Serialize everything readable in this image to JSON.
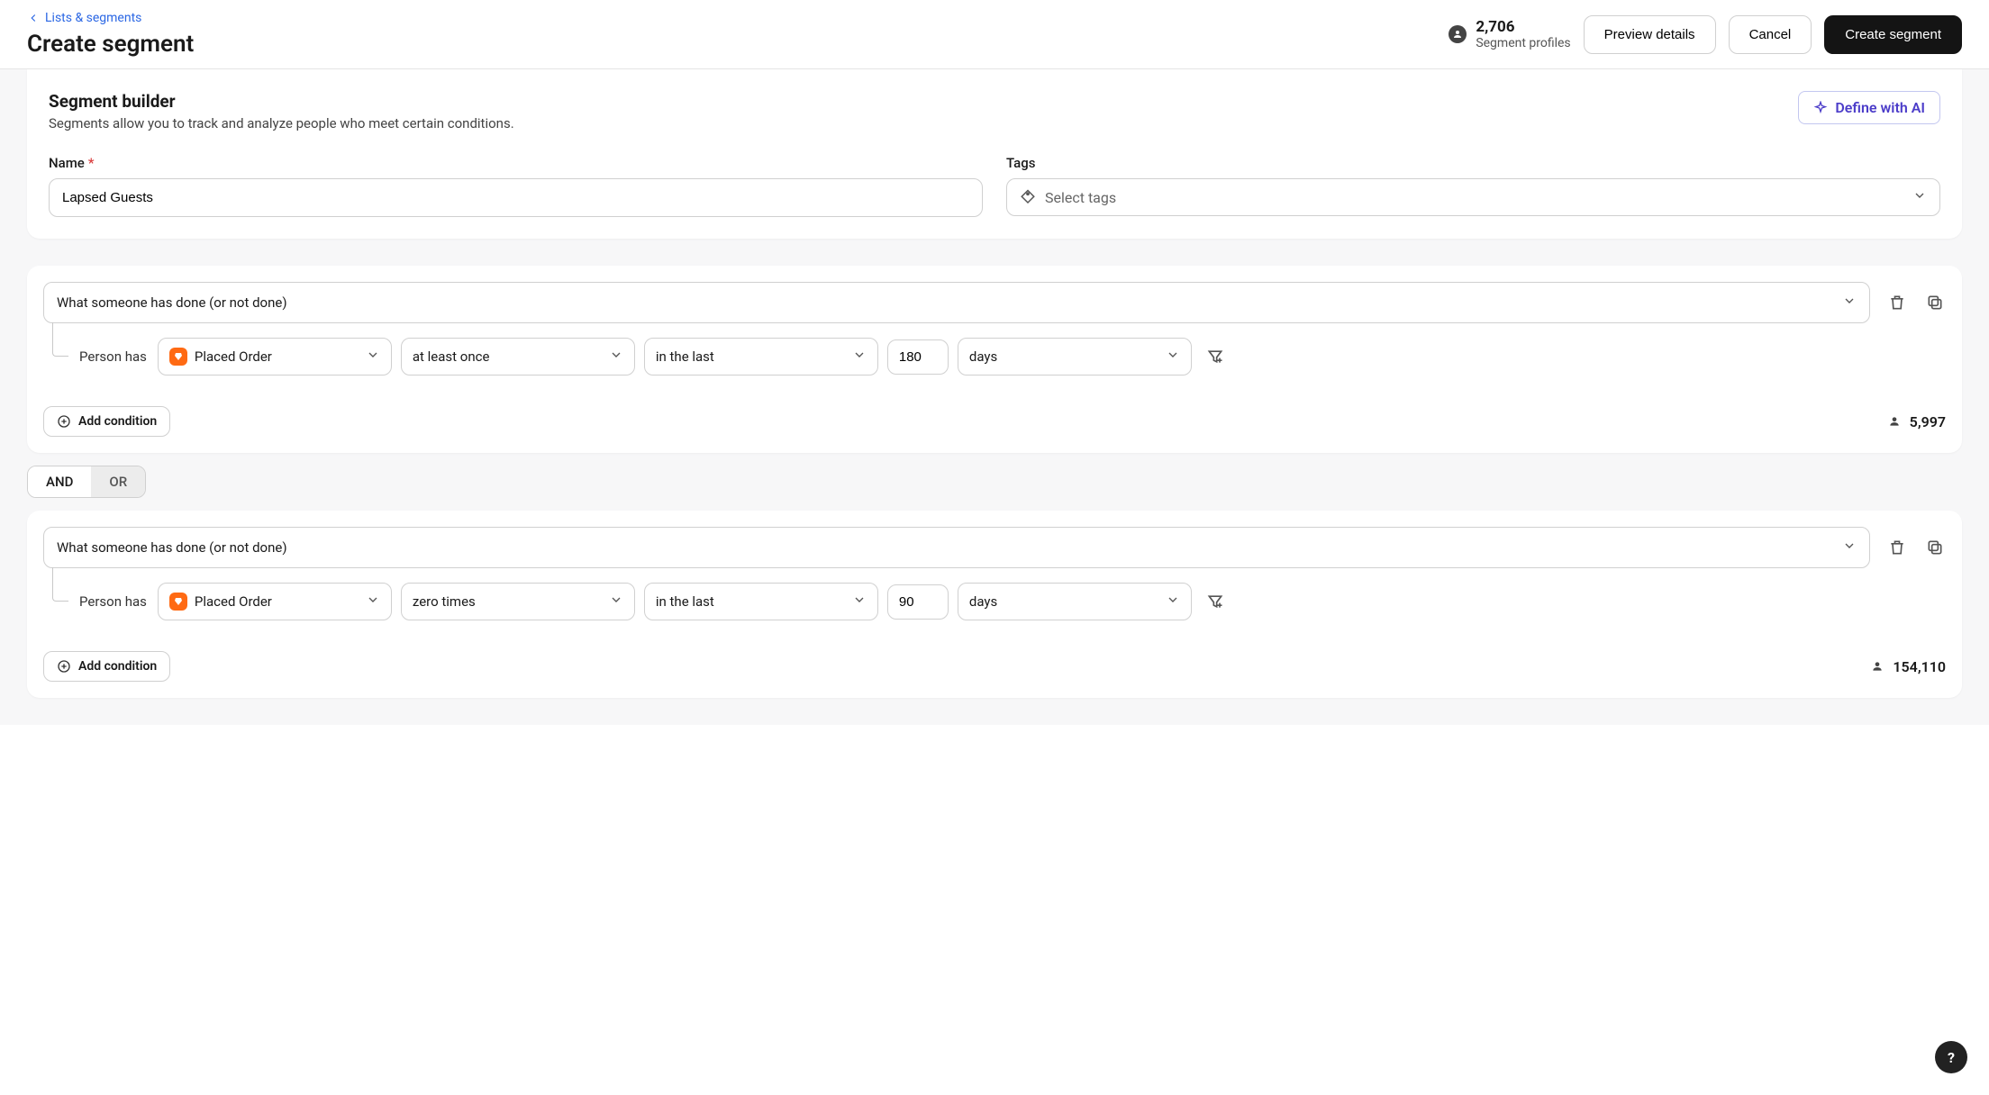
{
  "header": {
    "back_link": "Lists & segments",
    "title": "Create segment",
    "profiles_count": "2,706",
    "profiles_label": "Segment profiles",
    "preview_btn": "Preview details",
    "cancel_btn": "Cancel",
    "create_btn": "Create segment"
  },
  "builder": {
    "title": "Segment builder",
    "subtitle": "Segments allow you to track and analyze people who meet certain conditions.",
    "define_ai": "Define with AI",
    "name_label": "Name",
    "name_value": "Lapsed Guests",
    "tags_label": "Tags",
    "tags_placeholder": "Select tags"
  },
  "conditions": [
    {
      "type": "What someone has done (or not done)",
      "person_label": "Person has",
      "event": "Placed Order",
      "frequency": "at least once",
      "range": "in the last",
      "value": "180",
      "unit": "days",
      "count": "5,997"
    },
    {
      "type": "What someone has done (or not done)",
      "person_label": "Person has",
      "event": "Placed Order",
      "frequency": "zero times",
      "range": "in the last",
      "value": "90",
      "unit": "days",
      "count": "154,110"
    }
  ],
  "logic": {
    "and": "AND",
    "or": "OR"
  },
  "add_condition": "Add condition",
  "help": "?"
}
